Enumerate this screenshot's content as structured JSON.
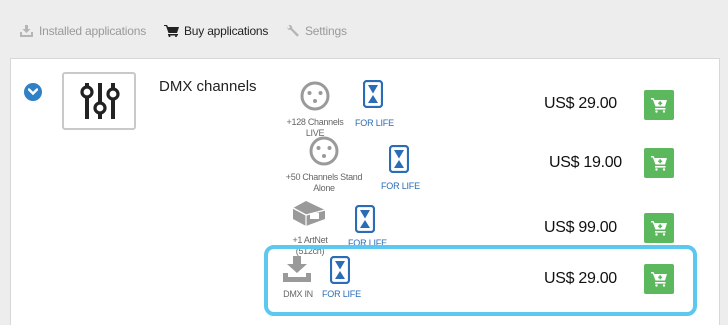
{
  "tabs": {
    "installed": "Installed applications",
    "buy": "Buy applications",
    "settings": "Settings"
  },
  "app": {
    "name": "DMX channels"
  },
  "options": [
    {
      "label": "+128 Channels LIVE",
      "license": "FOR LIFE",
      "price": "US$ 29.00",
      "icon": "xlr-connector-icon"
    },
    {
      "label": "+50 Channels Stand Alone",
      "license": "FOR LIFE",
      "price": "US$ 19.00",
      "icon": "xlr-connector-icon"
    },
    {
      "label": "+1 ArtNet (512ch)",
      "license": "FOR LIFE",
      "price": "US$ 99.00",
      "icon": "network-port-icon"
    },
    {
      "label": "DMX IN",
      "license": "FOR LIFE",
      "price": "US$ 29.00",
      "icon": "download-tray-icon"
    }
  ],
  "colors": {
    "accent_blue": "#2f80c5",
    "cart_green": "#5cb85c",
    "highlight": "#5bc8ef",
    "license_blue": "#2a6cb5"
  }
}
